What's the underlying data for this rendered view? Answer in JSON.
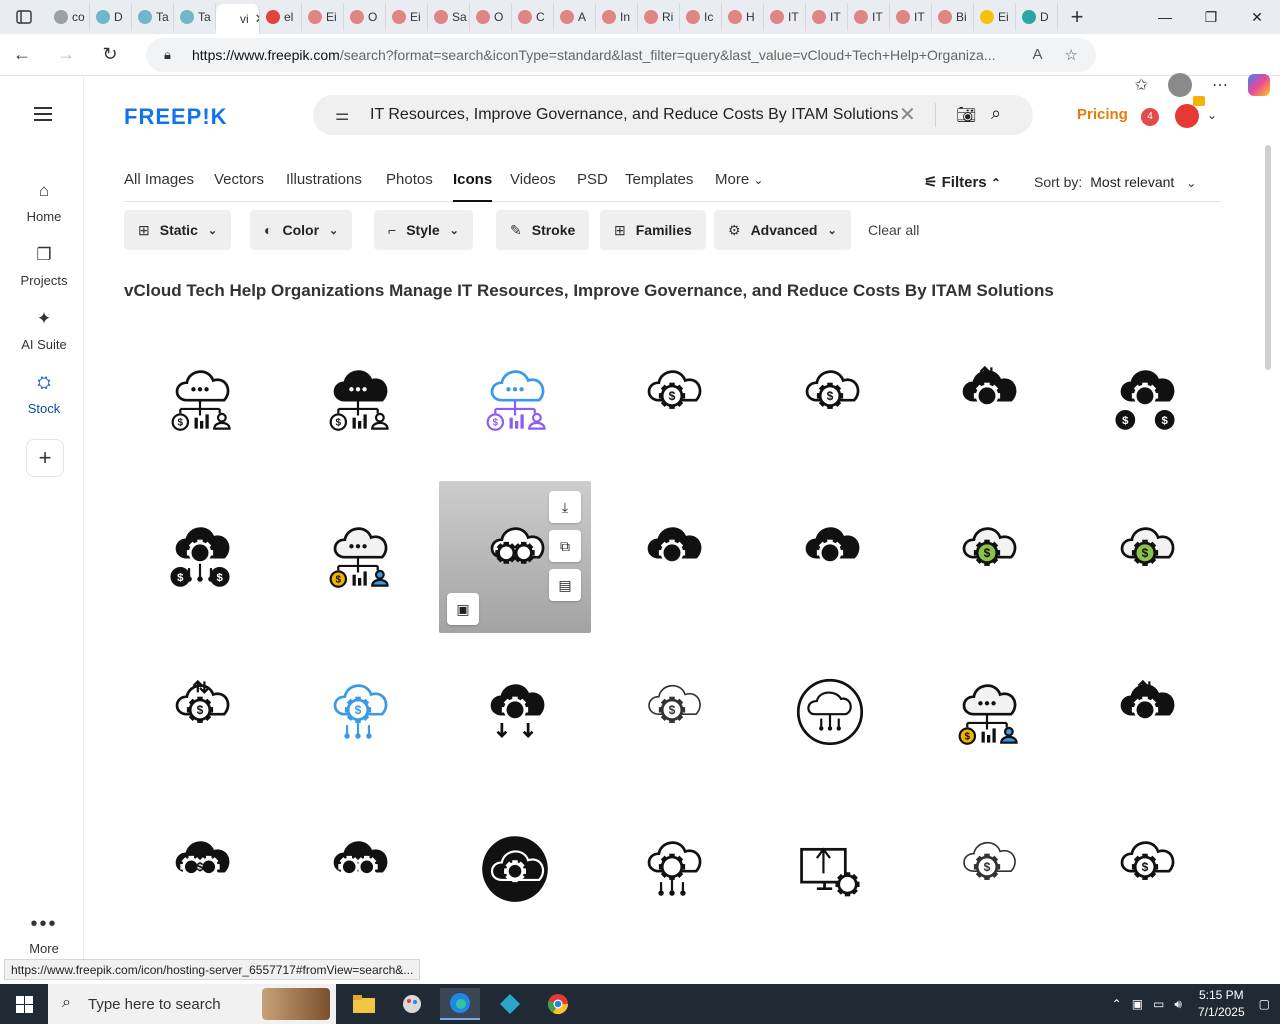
{
  "browser": {
    "tabs": [
      {
        "label": "co",
        "color": "#9aa0a6"
      },
      {
        "label": "D",
        "color": "#6fb7c9"
      },
      {
        "label": "Ta",
        "color": "#6fb7c9"
      },
      {
        "label": "Ta",
        "color": "#6fb7c9"
      },
      {
        "label": "vi",
        "color": "#ffffff",
        "active": true
      },
      {
        "label": "el",
        "color": "#e0443e"
      },
      {
        "label": "Ei",
        "color": "#e08585"
      },
      {
        "label": "O",
        "color": "#e08585"
      },
      {
        "label": "Ei",
        "color": "#e08585"
      },
      {
        "label": "Sa",
        "color": "#e08585"
      },
      {
        "label": "O",
        "color": "#e08585"
      },
      {
        "label": "C",
        "color": "#e08585"
      },
      {
        "label": "A",
        "color": "#e08585"
      },
      {
        "label": "In",
        "color": "#e08585"
      },
      {
        "label": "Ri",
        "color": "#e08585"
      },
      {
        "label": "Ic",
        "color": "#e08585"
      },
      {
        "label": "H",
        "color": "#e08585"
      },
      {
        "label": "IT",
        "color": "#e08585"
      },
      {
        "label": "IT",
        "color": "#e08585"
      },
      {
        "label": "IT",
        "color": "#e08585"
      },
      {
        "label": "IT",
        "color": "#e08585"
      },
      {
        "label": "Bi",
        "color": "#e08585"
      },
      {
        "label": "Ei",
        "color": "#f4c20d"
      },
      {
        "label": "D",
        "color": "#2ba6a6"
      }
    ],
    "active_tab_close": "✕",
    "new_tab": "+",
    "window_controls": [
      "—",
      "❐",
      "✕"
    ],
    "url_host": "https://www.freepik.com",
    "url_path": "/search?format=search&iconType=standard&last_filter=query&last_value=vCloud+Tech+Help+Organiza...",
    "status_url": "https://www.freepik.com/icon/hosting-server_6557717#fromView=search&..."
  },
  "sidebar": {
    "items": [
      {
        "label": "Home",
        "icon": "home-icon",
        "glyph": "⌂"
      },
      {
        "label": "Projects",
        "icon": "projects-icon",
        "glyph": "❐"
      },
      {
        "label": "AI Suite",
        "icon": "sparkle-icon",
        "glyph": "✦"
      },
      {
        "label": "Stock",
        "icon": "stock-icon",
        "glyph": "⛭"
      }
    ],
    "more_label": "More"
  },
  "header": {
    "logo": "FREEP!K",
    "search_query": "IT Resources, Improve Governance, and Reduce Costs By ITAM Solutions",
    "pricing": "Pricing",
    "notification_count": "4"
  },
  "type_tabs": [
    {
      "label": "All Images"
    },
    {
      "label": "Vectors"
    },
    {
      "label": "Illustrations"
    },
    {
      "label": "Photos"
    },
    {
      "label": "Icons",
      "active": true
    },
    {
      "label": "Videos"
    },
    {
      "label": "PSD"
    },
    {
      "label": "Templates"
    },
    {
      "label": "More"
    }
  ],
  "toolbar": {
    "filters_label": "Filters",
    "sort_label": "Sort by:",
    "sort_value": "Most relevant"
  },
  "chips": [
    {
      "label": "Static",
      "icon": "static-icon",
      "glyph": "⊞",
      "dropdown": true
    },
    {
      "label": "Color",
      "icon": "palette-icon",
      "glyph": "◐",
      "dropdown": true
    },
    {
      "label": "Style",
      "icon": "brush-icon",
      "glyph": "⌐",
      "dropdown": true
    },
    {
      "label": "Stroke",
      "icon": "pen-icon",
      "glyph": "✎",
      "dropdown": false
    },
    {
      "label": "Families",
      "icon": "grid-icon",
      "glyph": "⊞",
      "dropdown": false
    },
    {
      "label": "Advanced",
      "icon": "gear-icon",
      "glyph": "⚙",
      "dropdown": true
    }
  ],
  "clear_all": "Clear all",
  "results_heading": "vCloud Tech Help Organizations Manage IT Resources, Improve Governance, and Reduce Costs By ITAM Solutions",
  "icons": [
    {
      "name": "cloud-network-people-icon",
      "style": "line"
    },
    {
      "name": "cloud-network-people-icon",
      "style": "glyph"
    },
    {
      "name": "cloud-network-people-icon",
      "style": "gradient"
    },
    {
      "name": "cloud-gear-dollar-icon",
      "style": "line"
    },
    {
      "name": "cloud-gear-dollar-icon",
      "style": "line"
    },
    {
      "name": "cloud-transfer-dollar-icon",
      "style": "glyph"
    },
    {
      "name": "cloud-gear-dollars-icon",
      "style": "glyph"
    },
    {
      "name": "cloud-dollar-network-icon",
      "style": "glyph"
    },
    {
      "name": "cloud-network-people-icon",
      "style": "color"
    },
    {
      "name": "cloud-gears-coins-icon",
      "style": "line",
      "hovered": true
    },
    {
      "name": "cloud-gear-dollar-icon",
      "style": "glyph"
    },
    {
      "name": "cloud-gear-dollar-icon",
      "style": "glyph"
    },
    {
      "name": "cloud-gear-dollar-icon",
      "style": "color"
    },
    {
      "name": "cloud-gear-dollar-icon",
      "style": "color"
    },
    {
      "name": "cloud-transfer-dollar-icon",
      "style": "line"
    },
    {
      "name": "cloud-network-gear-dollar-icon",
      "style": "gradient"
    },
    {
      "name": "cloud-gear-download-icon",
      "style": "glyph"
    },
    {
      "name": "cloud-gear-dollar-icon",
      "style": "thin"
    },
    {
      "name": "cloud-circle-network-icon",
      "style": "line"
    },
    {
      "name": "cloud-network-people-icon",
      "style": "color"
    },
    {
      "name": "cloud-transfer-dollar-icon",
      "style": "glyph"
    },
    {
      "name": "cloud-gears-dollar-icon",
      "style": "glyph"
    },
    {
      "name": "cloud-gear-coins-icon",
      "style": "glyph"
    },
    {
      "name": "cloud-gear-circle-icon",
      "style": "badge"
    },
    {
      "name": "cloud-gear-network-icon",
      "style": "line"
    },
    {
      "name": "monitor-transfer-gear-icon",
      "style": "line"
    },
    {
      "name": "cloud-gear-dollar-icon",
      "style": "thin"
    },
    {
      "name": "cloud-gear-dollar-icon",
      "style": "line"
    }
  ],
  "hover_actions": [
    "download-icon",
    "copy-icon",
    "add-to-collection-icon",
    "edit-image-icon"
  ],
  "taskbar": {
    "search_placeholder": "Type here to search",
    "time": "5:15 PM",
    "date": "7/1/2025"
  },
  "colors": {
    "brand": "#1273eb",
    "pricing": "#e77a0c",
    "gradient_icon": "#8b5cf6",
    "icon_blue": "#3b9ae8",
    "icon_green": "#8bc34a",
    "icon_yellow": "#f4b400"
  }
}
